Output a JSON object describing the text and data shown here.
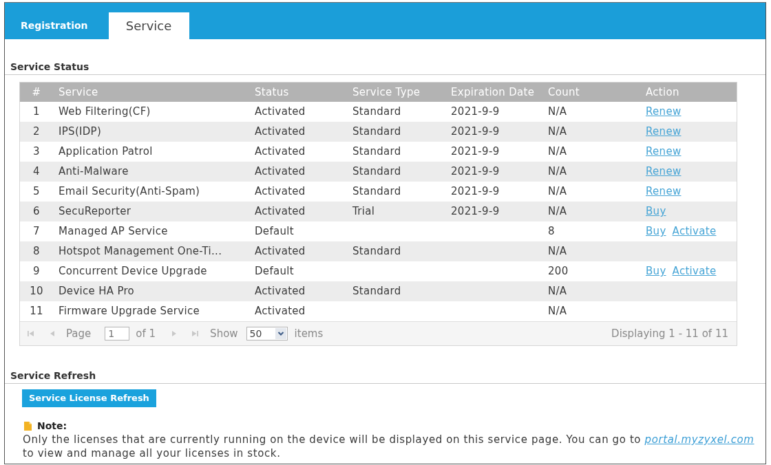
{
  "tabs": [
    {
      "label": "Registration",
      "selected": false
    },
    {
      "label": "Service",
      "selected": true
    }
  ],
  "service_status": {
    "title": "Service Status",
    "table": {
      "columns": [
        "#",
        "Service",
        "Status",
        "Service Type",
        "Expiration Date",
        "Count",
        "Action"
      ],
      "rows": [
        {
          "number": "1",
          "service": "Web Filtering(CF)",
          "status": "Activated",
          "service_type": "Standard",
          "expiration_date": "2021-9-9",
          "count": "N/A",
          "actions": [
            "Renew"
          ]
        },
        {
          "number": "2",
          "service": "IPS(IDP)",
          "status": "Activated",
          "service_type": "Standard",
          "expiration_date": "2021-9-9",
          "count": "N/A",
          "actions": [
            "Renew"
          ]
        },
        {
          "number": "3",
          "service": "Application Patrol",
          "status": "Activated",
          "service_type": "Standard",
          "expiration_date": "2021-9-9",
          "count": "N/A",
          "actions": [
            "Renew"
          ]
        },
        {
          "number": "4",
          "service": "Anti-Malware",
          "status": "Activated",
          "service_type": "Standard",
          "expiration_date": "2021-9-9",
          "count": "N/A",
          "actions": [
            "Renew"
          ]
        },
        {
          "number": "5",
          "service": "Email Security(Anti-Spam)",
          "status": "Activated",
          "service_type": "Standard",
          "expiration_date": "2021-9-9",
          "count": "N/A",
          "actions": [
            "Renew"
          ]
        },
        {
          "number": "6",
          "service": "SecuReporter",
          "status": "Activated",
          "service_type": "Trial",
          "expiration_date": "2021-9-9",
          "count": "N/A",
          "actions": [
            "Buy"
          ]
        },
        {
          "number": "7",
          "service": "Managed AP Service",
          "status": "Default",
          "count": "8",
          "actions": [
            "Buy",
            "Activate"
          ]
        },
        {
          "number": "8",
          "service": "Hotspot Management One-Ti...",
          "status": "Activated",
          "service_type": "Standard",
          "count": "N/A"
        },
        {
          "number": "9",
          "service": "Concurrent Device Upgrade",
          "status": "Default",
          "count": "200",
          "actions": [
            "Buy",
            "Activate"
          ]
        },
        {
          "number": "10",
          "service": "Device HA Pro",
          "status": "Activated",
          "service_type": "Standard",
          "count": "N/A"
        },
        {
          "number": "11",
          "service": "Firmware Upgrade Service",
          "status": "Activated",
          "count": "N/A"
        }
      ]
    },
    "pager": {
      "buttons": [
        {
          "kind": "first",
          "disabled": true
        },
        {
          "kind": "previous",
          "disabled": true
        },
        {
          "kind": "next",
          "disabled": true
        },
        {
          "kind": "last",
          "disabled": true
        }
      ],
      "page_label": "Page",
      "page": "1",
      "page_count": "of 1",
      "show_label": "Show",
      "page_size": "50",
      "items_label": "items",
      "summary": "Displaying 1 - 11 of 11"
    }
  },
  "service_refresh": {
    "title": "Service Refresh",
    "button": "Service License Refresh",
    "note": {
      "title": "Note:",
      "text": "Only the licenses that are currently running on the device will be displayed on this service page. You can go to",
      "link": "portal.myzyxel.com",
      "text_end": "to view and manage all your licenses in stock."
    }
  }
}
